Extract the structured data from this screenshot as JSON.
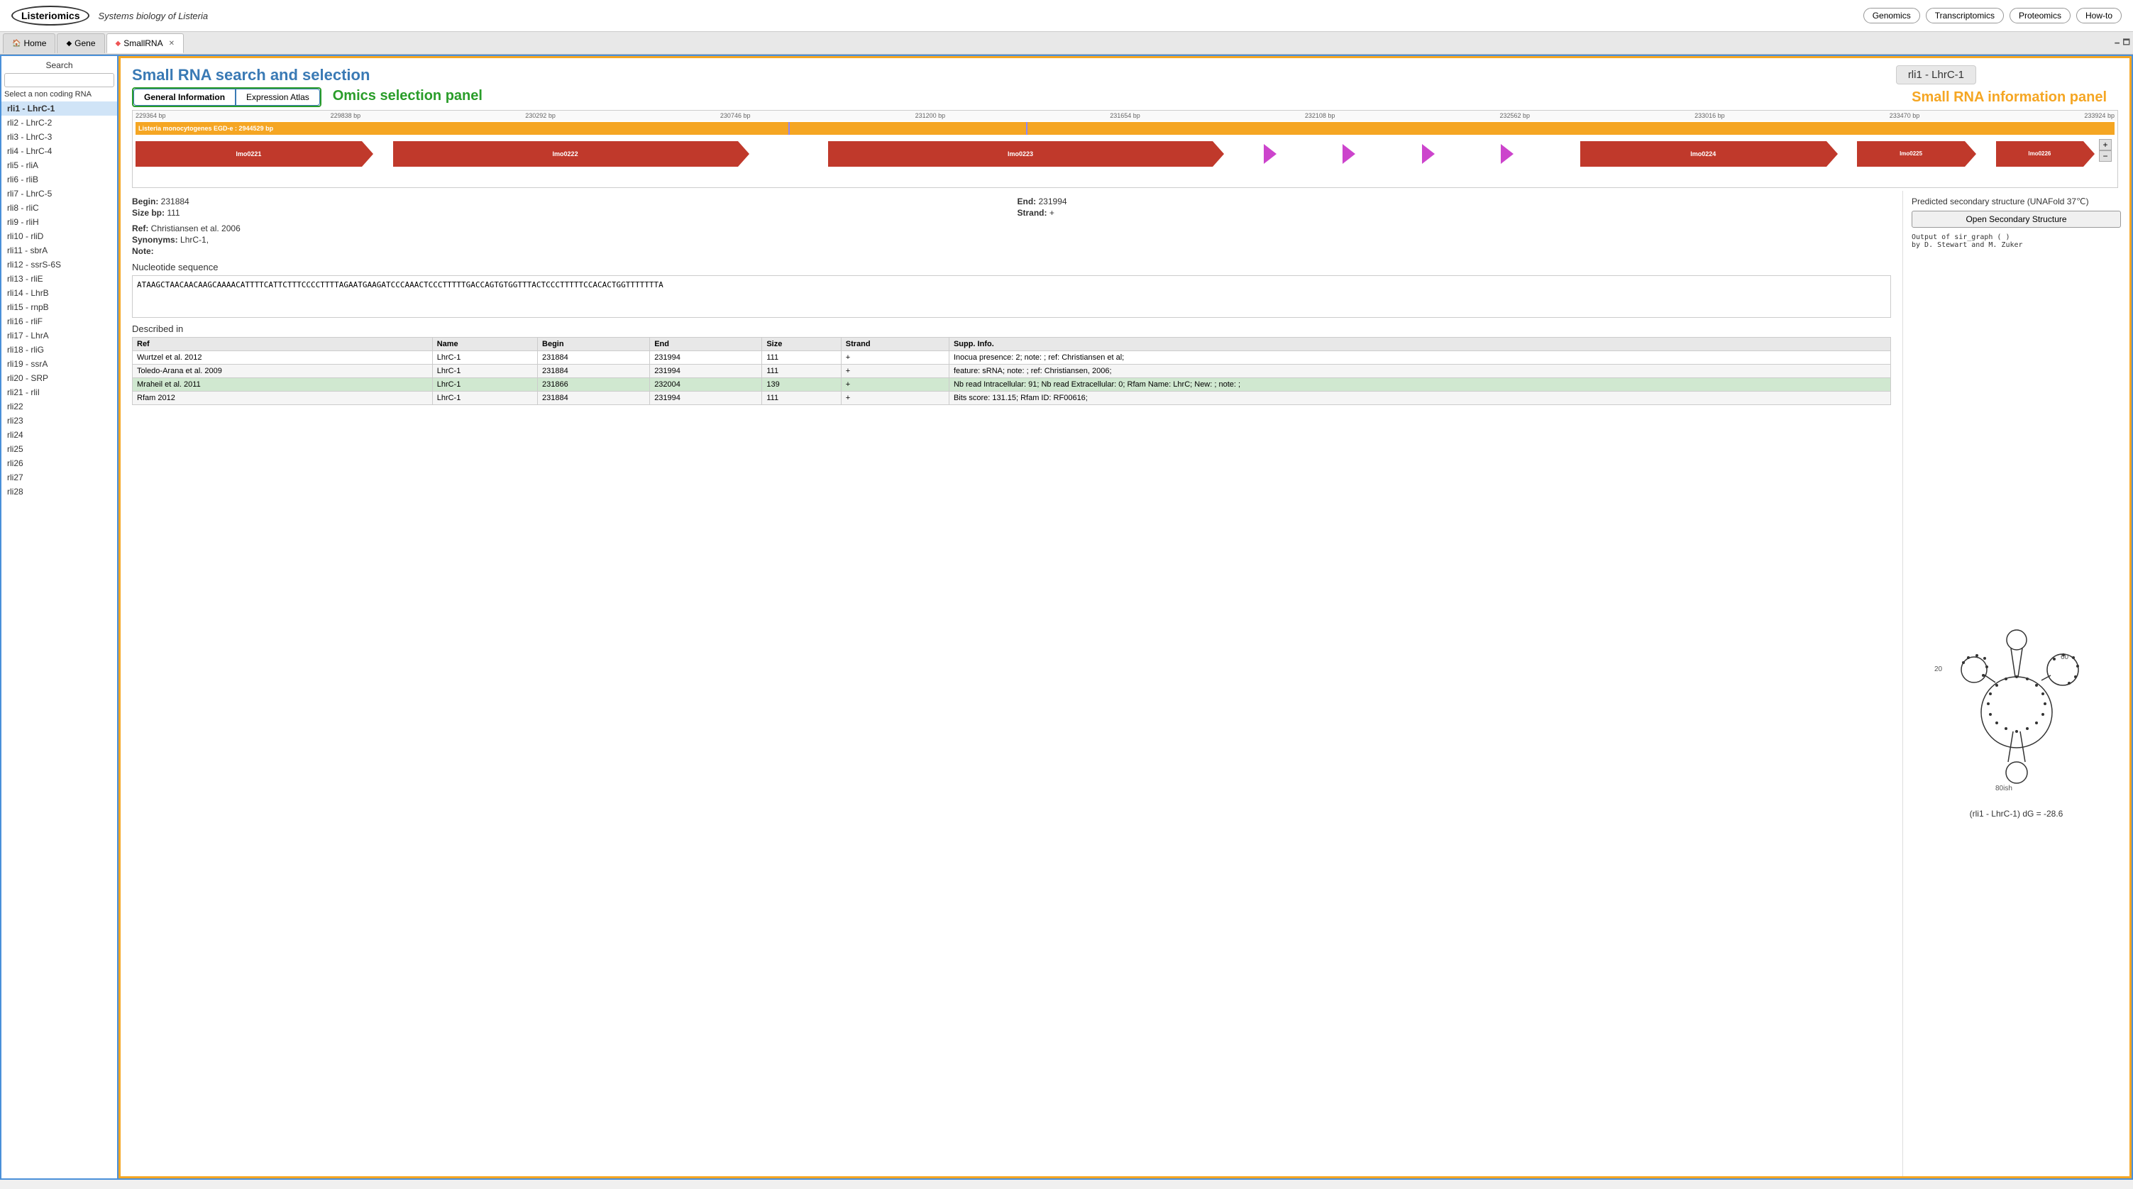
{
  "header": {
    "logo": "Listeriomics",
    "tagline": "Systems biology of Listeria",
    "nav": [
      "Genomics",
      "Transcriptomics",
      "Proteomics",
      "How-to"
    ]
  },
  "tabs": [
    {
      "id": "home",
      "label": "Home",
      "icon": "🏠",
      "active": false,
      "closable": false
    },
    {
      "id": "gene",
      "label": "Gene",
      "icon": "◆",
      "active": false,
      "closable": false
    },
    {
      "id": "smallrna",
      "label": "SmallRNA",
      "icon": "◆",
      "active": true,
      "closable": true
    }
  ],
  "sidebar": {
    "search_label": "Search",
    "search_placeholder": "",
    "select_label": "Select a non coding RNA",
    "items": [
      {
        "id": "rli1",
        "label": "rli1 - LhrC-1",
        "active": true
      },
      {
        "id": "rli2",
        "label": "rli2 - LhrC-2"
      },
      {
        "id": "rli3",
        "label": "rli3 - LhrC-3"
      },
      {
        "id": "rli4",
        "label": "rli4 - LhrC-4"
      },
      {
        "id": "rli5",
        "label": "rli5 - rliA"
      },
      {
        "id": "rli6",
        "label": "rli6 - rliB"
      },
      {
        "id": "rli7",
        "label": "rli7 - LhrC-5"
      },
      {
        "id": "rli8",
        "label": "rli8 - rliC"
      },
      {
        "id": "rli9",
        "label": "rli9 - rliH"
      },
      {
        "id": "rli10",
        "label": "rli10 - rliD"
      },
      {
        "id": "rli11",
        "label": "rli11 - sbrA"
      },
      {
        "id": "rli12",
        "label": "rli12 - ssrS-6S"
      },
      {
        "id": "rli13",
        "label": "rli13 - rliE"
      },
      {
        "id": "rli14",
        "label": "rli14 - LhrB"
      },
      {
        "id": "rli15",
        "label": "rli15 - rnpB"
      },
      {
        "id": "rli16",
        "label": "rli16 - rliF"
      },
      {
        "id": "rli17",
        "label": "rli17 - LhrA"
      },
      {
        "id": "rli18",
        "label": "rli18 - rliG"
      },
      {
        "id": "rli19",
        "label": "rli19 - ssrA"
      },
      {
        "id": "rli20",
        "label": "rli20 - SRP"
      },
      {
        "id": "rli21",
        "label": "rli21 - rliI"
      },
      {
        "id": "rli22",
        "label": "rli22"
      },
      {
        "id": "rli23",
        "label": "rli23"
      },
      {
        "id": "rli24",
        "label": "rli24"
      },
      {
        "id": "rli25",
        "label": "rli25"
      },
      {
        "id": "rli26",
        "label": "rli26"
      },
      {
        "id": "rli27",
        "label": "rli27"
      },
      {
        "id": "rli28",
        "label": "rli28"
      }
    ]
  },
  "panel": {
    "title": "Small RNA search and selection",
    "current_item": "rli1 - LhrC-1",
    "omics_label": "Omics selection panel",
    "info_label": "Small RNA information panel",
    "sub_tabs": [
      "General Information",
      "Expression Atlas"
    ],
    "active_sub_tab": "General Information"
  },
  "genome_viewer": {
    "ruler": [
      "229364 bp",
      "229838 bp",
      "230292 bp",
      "230746 bp",
      "231200 bp",
      "231654 bp",
      "232108 bp",
      "232562 bp",
      "233016 bp",
      "233470 bp",
      "233924 bp"
    ],
    "track_label": "Listeria monocytogenes EGD-e : 2944529 bp",
    "genes": [
      {
        "id": "lmo0221",
        "label": "lmo0221",
        "left_pct": 0,
        "width_pct": 12
      },
      {
        "id": "lmo0222",
        "label": "lmo0222",
        "left_pct": 13,
        "width_pct": 17
      },
      {
        "id": "lmo0223",
        "label": "lmo0223",
        "left_pct": 35,
        "width_pct": 18
      },
      {
        "id": "lmo0224",
        "label": "lmo0224",
        "left_pct": 67,
        "width_pct": 16
      },
      {
        "id": "lmo0225",
        "label": "lmo0225",
        "left_pct": 85,
        "width_pct": 7
      },
      {
        "id": "lmo0226",
        "label": "lmo0226",
        "left_pct": 93,
        "width_pct": 6
      }
    ],
    "small_arrows": [
      {
        "left_pct": 55
      },
      {
        "left_pct": 59
      },
      {
        "left_pct": 63
      },
      {
        "left_pct": 67
      }
    ]
  },
  "metadata": {
    "begin_label": "Begin:",
    "begin_value": "231884",
    "end_label": "End:",
    "end_value": "231994",
    "size_label": "Size bp:",
    "size_value": "111",
    "strand_label": "Strand:",
    "strand_value": "+",
    "ref_label": "Ref:",
    "ref_value": "Christiansen et al. 2006",
    "synonyms_label": "Synonyms:",
    "synonyms_value": "LhrC-1,",
    "note_label": "Note:",
    "note_value": ""
  },
  "sequence": {
    "label": "Nucleotide sequence",
    "value": "ATAAGCTAACAACAAGCAAAACATTTTCATTCTTTCCCCTTTTAGAATGAAGATCCCAAACTCCCTTTTTGACCAGTGTGGTTTACTCCCTTTTTCCACACTGGTTTTTTTA"
  },
  "described_in": {
    "label": "Described in",
    "columns": [
      "Ref",
      "Name",
      "Begin",
      "End",
      "Size",
      "Strand",
      "Supp. Info."
    ],
    "rows": [
      {
        "ref": "Wurtzel et al. 2012",
        "name": "LhrC-1",
        "begin": "231884",
        "end": "231994",
        "size": "111",
        "strand": "+",
        "supp": "Inocua presence: 2; note: ; ref: Christiansen et al;",
        "highlight": false
      },
      {
        "ref": "Toledo-Arana et al. 2009",
        "name": "LhrC-1",
        "begin": "231884",
        "end": "231994",
        "size": "111",
        "strand": "+",
        "supp": "feature: sRNA; note: ; ref: Christiansen, 2006;",
        "highlight": false
      },
      {
        "ref": "Mraheil et al. 2011",
        "name": "LhrC-1",
        "begin": "231866",
        "end": "232004",
        "size": "139",
        "strand": "+",
        "supp": "Nb read Intracellular: 91; Nb read Extracellular: 0; Rfam Name: LhrC; New: ; note: ;",
        "highlight": true
      },
      {
        "ref": "Rfam 2012",
        "name": "LhrC-1",
        "begin": "231884",
        "end": "231994",
        "size": "111",
        "strand": "+",
        "supp": "Bits score: 131.15; Rfam ID: RF00616;",
        "highlight": false
      }
    ]
  },
  "secondary_structure": {
    "title": "Predicted secondary structure (UNAFold 37℃)",
    "button_label": "Open Secondary Structure",
    "output_line1": "Output of sir_graph ( )",
    "output_line2": "by D. Stewart and M. Zuker",
    "caption": "(rli1 - LhrC-1) dG = -28.6"
  }
}
